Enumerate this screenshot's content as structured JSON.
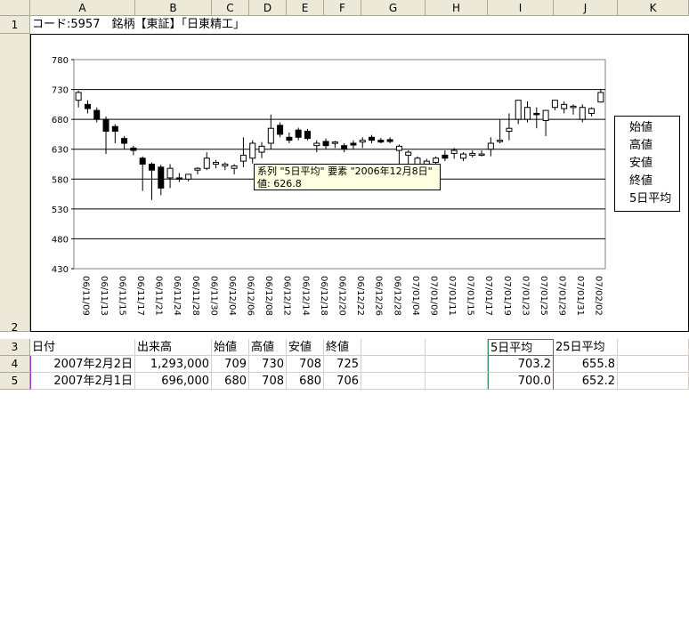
{
  "columns": [
    "A",
    "B",
    "C",
    "D",
    "E",
    "F",
    "G",
    "H",
    "I",
    "J",
    "K"
  ],
  "rows": [
    "1",
    "2",
    "3",
    "4",
    "5"
  ],
  "row1_text": "コード:5957　銘柄【東証】「日東精工」",
  "header_row": {
    "a": "日付",
    "b": "出来高",
    "c": "始値",
    "d": "高値",
    "e": "安値",
    "f": "終値",
    "i": "5日平均",
    "j": "25日平均"
  },
  "data_rows": [
    {
      "a": "2007年2月2日",
      "b": "1,293,000",
      "c": "709",
      "d": "730",
      "e": "708",
      "f": "725",
      "i": "703.2",
      "j": "655.8"
    },
    {
      "a": "2007年2月1日",
      "b": "696,000",
      "c": "680",
      "d": "708",
      "e": "680",
      "f": "706",
      "i": "700.0",
      "j": "652.2"
    }
  ],
  "tooltip": {
    "line1": "系列 \"5日平均\" 要素 \"2006年12月8日\"",
    "line2": "値: 626.8"
  },
  "chart_data": {
    "type": "candlestick",
    "title": "",
    "ylim": [
      430,
      780
    ],
    "y_ticks": [
      430,
      480,
      530,
      580,
      630,
      680,
      730,
      780
    ],
    "x_tick_labels": [
      "06/11/09",
      "06/11/13",
      "06/11/15",
      "06/11/17",
      "06/11/21",
      "06/11/24",
      "06/11/28",
      "06/11/30",
      "06/12/04",
      "06/12/06",
      "06/12/08",
      "06/12/12",
      "06/12/14",
      "06/12/18",
      "06/12/20",
      "06/12/22",
      "06/12/26",
      "06/12/28",
      "07/01/04",
      "07/01/09",
      "07/01/11",
      "07/01/15",
      "07/01/17",
      "07/01/19",
      "07/01/23",
      "07/01/25",
      "07/01/29",
      "07/01/31",
      "07/02/02"
    ],
    "legend": [
      "始値",
      "高値",
      "安値",
      "終値",
      "5日平均"
    ],
    "candles": [
      {
        "o": 712,
        "h": 728,
        "l": 700,
        "c": 725
      },
      {
        "o": 705,
        "h": 712,
        "l": 690,
        "c": 698
      },
      {
        "o": 695,
        "h": 700,
        "l": 675,
        "c": 680
      },
      {
        "o": 680,
        "h": 685,
        "l": 622,
        "c": 660
      },
      {
        "o": 668,
        "h": 672,
        "l": 640,
        "c": 660
      },
      {
        "o": 648,
        "h": 652,
        "l": 630,
        "c": 640
      },
      {
        "o": 632,
        "h": 636,
        "l": 620,
        "c": 628
      },
      {
        "o": 615,
        "h": 618,
        "l": 560,
        "c": 605
      },
      {
        "o": 605,
        "h": 608,
        "l": 545,
        "c": 595
      },
      {
        "o": 600,
        "h": 604,
        "l": 553,
        "c": 565
      },
      {
        "o": 582,
        "h": 605,
        "l": 565,
        "c": 598
      },
      {
        "o": 582,
        "h": 590,
        "l": 575,
        "c": 580
      },
      {
        "o": 580,
        "h": 586,
        "l": 576,
        "c": 588
      },
      {
        "o": 595,
        "h": 600,
        "l": 588,
        "c": 598
      },
      {
        "o": 598,
        "h": 625,
        "l": 595,
        "c": 615
      },
      {
        "o": 605,
        "h": 612,
        "l": 598,
        "c": 608
      },
      {
        "o": 602,
        "h": 608,
        "l": 595,
        "c": 605
      },
      {
        "o": 598,
        "h": 605,
        "l": 588,
        "c": 602
      },
      {
        "o": 610,
        "h": 650,
        "l": 600,
        "c": 620
      },
      {
        "o": 615,
        "h": 645,
        "l": 606,
        "c": 640
      },
      {
        "o": 625,
        "h": 642,
        "l": 615,
        "c": 635
      },
      {
        "o": 640,
        "h": 688,
        "l": 630,
        "c": 665
      },
      {
        "o": 670,
        "h": 675,
        "l": 650,
        "c": 655
      },
      {
        "o": 650,
        "h": 658,
        "l": 640,
        "c": 645
      },
      {
        "o": 662,
        "h": 666,
        "l": 645,
        "c": 650
      },
      {
        "o": 660,
        "h": 664,
        "l": 645,
        "c": 648
      },
      {
        "o": 636,
        "h": 645,
        "l": 625,
        "c": 640
      },
      {
        "o": 643,
        "h": 648,
        "l": 630,
        "c": 636
      },
      {
        "o": 640,
        "h": 644,
        "l": 632,
        "c": 642
      },
      {
        "o": 636,
        "h": 640,
        "l": 625,
        "c": 630
      },
      {
        "o": 640,
        "h": 645,
        "l": 630,
        "c": 637
      },
      {
        "o": 642,
        "h": 650,
        "l": 632,
        "c": 645
      },
      {
        "o": 650,
        "h": 654,
        "l": 640,
        "c": 645
      },
      {
        "o": 645,
        "h": 649,
        "l": 640,
        "c": 642
      },
      {
        "o": 646,
        "h": 650,
        "l": 640,
        "c": 643
      },
      {
        "o": 628,
        "h": 638,
        "l": 602,
        "c": 635
      },
      {
        "o": 620,
        "h": 628,
        "l": 590,
        "c": 625
      },
      {
        "o": 605,
        "h": 618,
        "l": 600,
        "c": 615
      },
      {
        "o": 600,
        "h": 614,
        "l": 590,
        "c": 610
      },
      {
        "o": 608,
        "h": 618,
        "l": 604,
        "c": 615
      },
      {
        "o": 620,
        "h": 628,
        "l": 610,
        "c": 615
      },
      {
        "o": 623,
        "h": 632,
        "l": 614,
        "c": 628
      },
      {
        "o": 615,
        "h": 625,
        "l": 610,
        "c": 622
      },
      {
        "o": 620,
        "h": 628,
        "l": 616,
        "c": 623
      },
      {
        "o": 620,
        "h": 628,
        "l": 618,
        "c": 622
      },
      {
        "o": 630,
        "h": 650,
        "l": 618,
        "c": 640
      },
      {
        "o": 645,
        "h": 680,
        "l": 640,
        "c": 645
      },
      {
        "o": 660,
        "h": 690,
        "l": 645,
        "c": 665
      },
      {
        "o": 680,
        "h": 712,
        "l": 672,
        "c": 712
      },
      {
        "o": 680,
        "h": 710,
        "l": 675,
        "c": 700
      },
      {
        "o": 690,
        "h": 700,
        "l": 665,
        "c": 688
      },
      {
        "o": 678,
        "h": 692,
        "l": 652,
        "c": 695
      },
      {
        "o": 700,
        "h": 712,
        "l": 695,
        "c": 712
      },
      {
        "o": 698,
        "h": 710,
        "l": 690,
        "c": 705
      },
      {
        "o": 700,
        "h": 705,
        "l": 688,
        "c": 702
      },
      {
        "o": 680,
        "h": 705,
        "l": 675,
        "c": 700
      },
      {
        "o": 690,
        "h": 700,
        "l": 685,
        "c": 698
      },
      {
        "o": 709,
        "h": 730,
        "l": 708,
        "c": 725
      }
    ]
  }
}
